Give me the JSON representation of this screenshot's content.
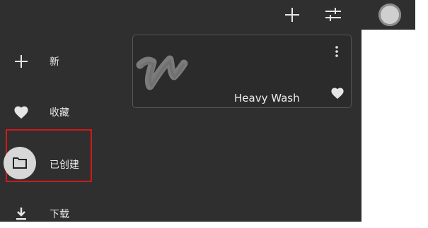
{
  "toolbar": {
    "add_icon": "plus-icon",
    "filter_icon": "tune-sliders-icon",
    "avatar_icon": "user-avatar"
  },
  "sidebar": {
    "items": [
      {
        "icon": "plus-icon",
        "label": "新"
      },
      {
        "icon": "heart-icon",
        "label": "收藏"
      },
      {
        "icon": "folder-icon",
        "label": "已创建",
        "selected": true
      },
      {
        "icon": "download-icon",
        "label": "下载"
      }
    ]
  },
  "brush_card": {
    "name": "Heavy Wash",
    "menu_icon": "more-vert-icon",
    "favorite_icon": "heart-icon"
  },
  "colors": {
    "panel_bg": "#2f2f2f",
    "highlight_border": "#d11a1a"
  }
}
